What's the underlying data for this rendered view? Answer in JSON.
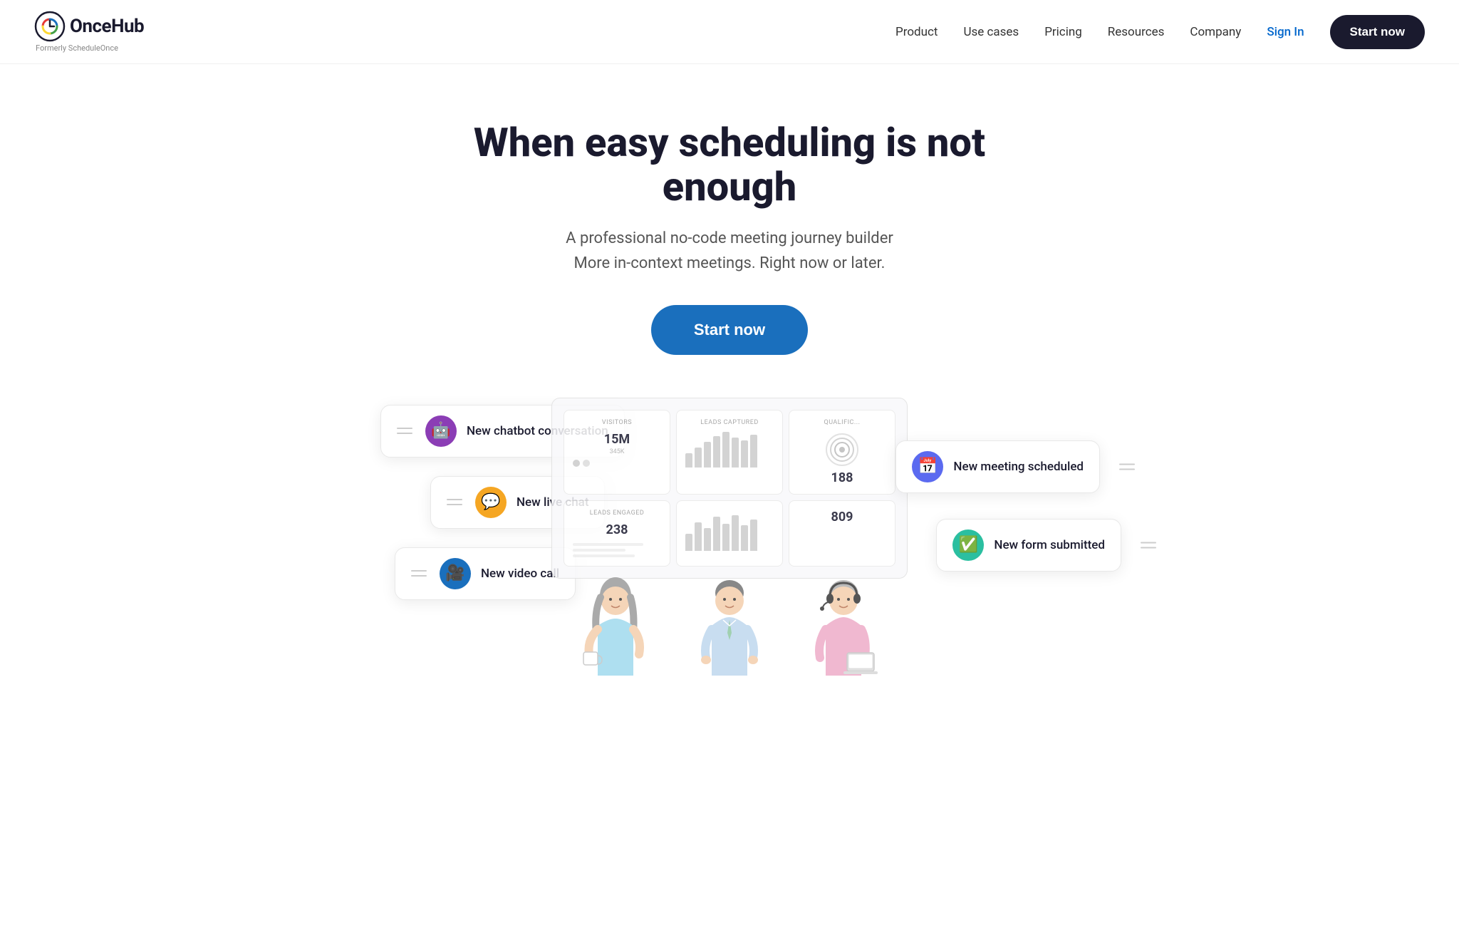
{
  "nav": {
    "logo_text": "OnceHub",
    "logo_sub": "Formerly ScheduleOnce",
    "links": [
      {
        "label": "Product",
        "id": "product"
      },
      {
        "label": "Use cases",
        "id": "use-cases"
      },
      {
        "label": "Pricing",
        "id": "pricing"
      },
      {
        "label": "Resources",
        "id": "resources"
      },
      {
        "label": "Company",
        "id": "company"
      }
    ],
    "signin_label": "Sign In",
    "start_label": "Start now"
  },
  "hero": {
    "heading": "When easy scheduling is not enough",
    "sub1": "A professional no-code meeting journey builder",
    "sub2": "More in-context meetings. Right now or later.",
    "cta_label": "Start now"
  },
  "notifications": [
    {
      "id": "chatbot",
      "label": "New chatbot conversation",
      "icon_color": "purple",
      "icon": "🤖",
      "position": "top-left"
    },
    {
      "id": "livechat",
      "label": "New live chat",
      "icon_color": "orange",
      "icon": "💬",
      "position": "mid-left"
    },
    {
      "id": "videocall",
      "label": "New video call",
      "icon_color": "blue-dark",
      "icon": "🎥",
      "position": "lower-left"
    },
    {
      "id": "meeting",
      "label": "New meeting scheduled",
      "icon_color": "blue-meeting",
      "icon": "📅",
      "position": "top-right"
    },
    {
      "id": "form",
      "label": "New form submitted",
      "icon_color": "teal",
      "icon": "✅",
      "position": "lower-right"
    }
  ],
  "dashboard": {
    "cards": [
      {
        "label": "VISITORS",
        "value": "15M",
        "sub": "345K"
      },
      {
        "label": "LEADS CAPTURED",
        "value": "",
        "bars": [
          20,
          35,
          45,
          60,
          70,
          80,
          65,
          75
        ]
      },
      {
        "label": "QUALIFICATIONS",
        "value": "188",
        "sub": ""
      }
    ],
    "cards2": [
      {
        "label": "LEADS ENGAGED",
        "value": "238",
        "sub": ""
      },
      {
        "label": "",
        "value": "",
        "bars": [
          30,
          50,
          40,
          70,
          60,
          80,
          55,
          65
        ]
      },
      {
        "label": "",
        "value": "809",
        "sub": ""
      }
    ]
  },
  "colors": {
    "primary_blue": "#1a6fbd",
    "dark": "#1a1a2e",
    "purple": "#8b3db5",
    "orange": "#f5a623",
    "teal": "#2bbfa0",
    "meeting_blue": "#5b6af0"
  }
}
